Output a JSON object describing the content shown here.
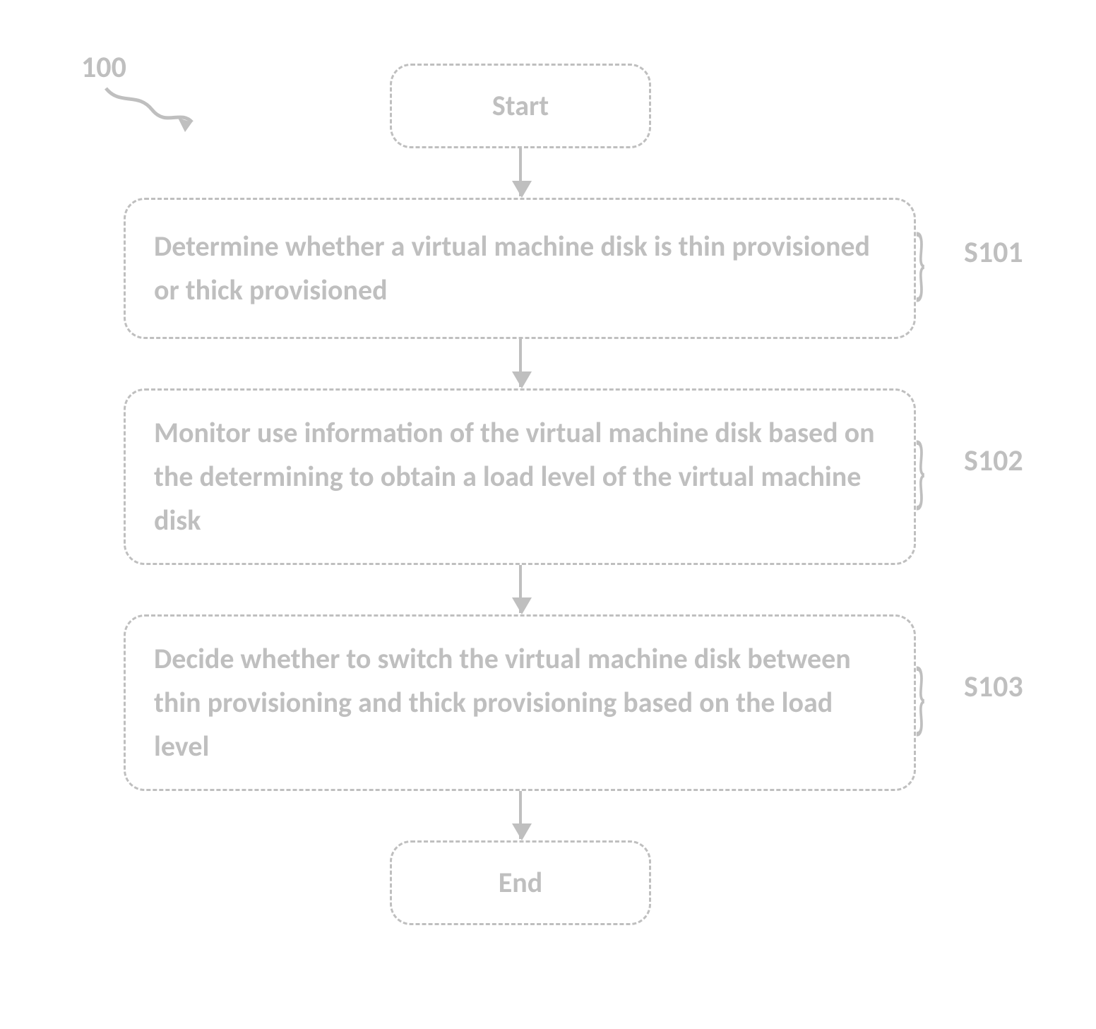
{
  "chart_data": {
    "type": "flowchart",
    "title": "",
    "nodes": [
      {
        "id": "start",
        "kind": "terminator",
        "label": "Start"
      },
      {
        "id": "s101",
        "kind": "process",
        "label": "Determine whether a virtual machine disk is thin provisioned or thick provisioned",
        "ref": "S101"
      },
      {
        "id": "s102",
        "kind": "process",
        "label": "Monitor use information of the virtual machine disk based on the determining to obtain a load level of the virtual machine disk",
        "ref": "S102"
      },
      {
        "id": "s103",
        "kind": "process",
        "label": "Decide whether to switch the virtual machine disk between thin provisioning and thick provisioning based on the load level",
        "ref": "S103"
      },
      {
        "id": "end",
        "kind": "terminator",
        "label": "End"
      }
    ],
    "edges": [
      {
        "from": "start",
        "to": "s101"
      },
      {
        "from": "s101",
        "to": "s102"
      },
      {
        "from": "s102",
        "to": "s103"
      },
      {
        "from": "s103",
        "to": "end"
      }
    ],
    "figure_ref": "100"
  },
  "flow": {
    "start": {
      "label": "Start"
    },
    "s101": {
      "label": "Determine whether a virtual machine disk is thin provisioned or thick provisioned",
      "ref": "S101"
    },
    "s102": {
      "label": "Monitor use information of the virtual machine disk based on the determining to obtain a load level of the virtual machine disk",
      "ref": "S102"
    },
    "s103": {
      "label": "Decide whether to switch the virtual machine disk between thin provisioning and thick provisioning based on the load level",
      "ref": "S103"
    },
    "end": {
      "label": "End"
    },
    "figref": "100"
  }
}
